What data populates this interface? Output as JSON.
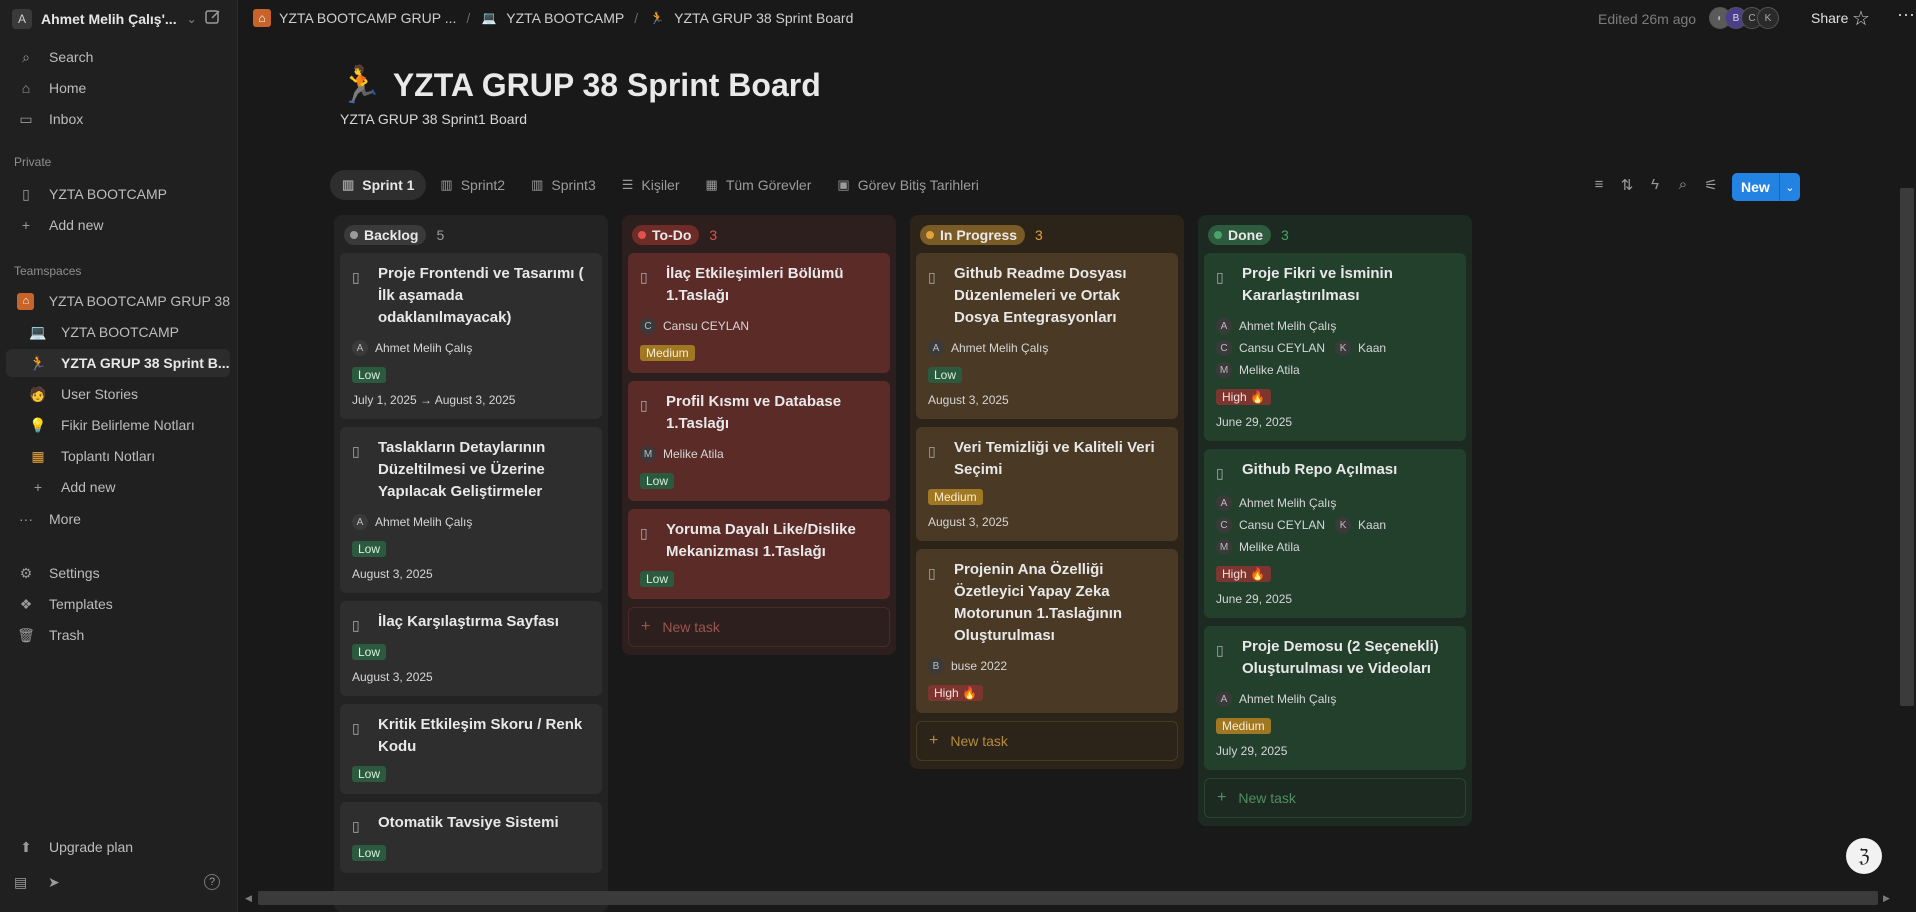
{
  "sidebar": {
    "workspace_initial": "A",
    "workspace_name": "Ahmet Melih Çalış'...",
    "nav": {
      "search": "Search",
      "home": "Home",
      "inbox": "Inbox"
    },
    "private_label": "Private",
    "private_items": [
      "YZTA BOOTCAMP"
    ],
    "add_new": "Add new",
    "teamspaces_label": "Teamspaces",
    "teamspace_root": "YZTA BOOTCAMP GRUP 38",
    "team_items": [
      {
        "label": "YZTA BOOTCAMP",
        "icon": "laptop-icon"
      },
      {
        "label": "YZTA GRUP 38 Sprint B...",
        "icon": "runner-icon"
      },
      {
        "label": "User Stories",
        "icon": "person-icon"
      },
      {
        "label": "Fikir Belirleme Notları",
        "icon": "lightbulb-icon"
      },
      {
        "label": "Toplantı Notları",
        "icon": "calendar-icon"
      }
    ],
    "team_add_new": "Add new",
    "more": "More",
    "settings": "Settings",
    "templates": "Templates",
    "trash": "Trash",
    "upgrade": "Upgrade plan"
  },
  "topbar": {
    "breadcrumbs": [
      "YZTA BOOTCAMP GRUP ...",
      "YZTA BOOTCAMP",
      "YZTA GRUP 38 Sprint Board"
    ],
    "edited": "Edited 26m ago",
    "avatars": [
      "B",
      "C",
      "K"
    ],
    "share": "Share"
  },
  "page": {
    "icon": "🏃",
    "title": "YZTA GRUP 38 Sprint Board",
    "subtitle": "YZTA GRUP 38 Sprint1 Board"
  },
  "tabs": [
    "Sprint 1",
    "Sprint2",
    "Sprint3",
    "Kişiler",
    "Tüm Görevler",
    "Görev Bitiş Tarihleri"
  ],
  "new_button": "New",
  "board": {
    "new_task": "New task",
    "columns": [
      {
        "name": "Backlog",
        "count": "5",
        "color": "#9b9b9b",
        "cards": [
          {
            "title": "Proje Frontendi ve Tasarımı ( İlk aşamada odaklanılmayacak)",
            "people": [
              [
                "A",
                "Ahmet Melih Çalış"
              ]
            ],
            "priority": "Low",
            "date": "July 1, 2025 → August 3, 2025"
          },
          {
            "title": "Taslakların Detaylarının Düzeltilmesi ve Üzerine Yapılacak Geliştirmeler",
            "people": [
              [
                "A",
                "Ahmet Melih Çalış"
              ]
            ],
            "priority": "Low",
            "date": "August 3, 2025"
          },
          {
            "title": "İlaç Karşılaştırma Sayfası",
            "people": [],
            "priority": "Low",
            "date": "August 3, 2025"
          },
          {
            "title": "Kritik Etkileşim Skoru / Renk Kodu",
            "people": [],
            "priority": "Low",
            "date": ""
          },
          {
            "title": "Otomatik Tavsiye Sistemi",
            "people": [],
            "priority": "Low",
            "date": ""
          }
        ]
      },
      {
        "name": "To-Do",
        "count": "3",
        "color": "#e0524b",
        "cards": [
          {
            "title": "İlaç Etkileşimleri Bölümü 1.Taslağı",
            "people": [
              [
                "C",
                "Cansu CEYLAN"
              ]
            ],
            "priority": "Medium",
            "date": ""
          },
          {
            "title": "Profil Kısmı ve Database 1.Taslağı",
            "people": [
              [
                "M",
                "Melike Atila"
              ]
            ],
            "priority": "Low",
            "date": ""
          },
          {
            "title": "Yoruma Dayalı Like/Dislike Mekanizması 1.Taslağı",
            "people": [],
            "priority": "Low",
            "date": ""
          }
        ]
      },
      {
        "name": "In Progress",
        "count": "3",
        "color": "#e0a23b",
        "cards": [
          {
            "title": "Github Readme Dosyası Düzenlemeleri ve Ortak Dosya Entegrasyonları",
            "people": [
              [
                "A",
                "Ahmet Melih Çalış"
              ]
            ],
            "priority": "Low",
            "date": "August 3, 2025"
          },
          {
            "title": "Veri Temizliği ve Kaliteli Veri Seçimi",
            "people": [],
            "priority": "Medium",
            "date": "August 3, 2025"
          },
          {
            "title": "Projenin Ana Özelliği Özetleyici Yapay Zeka Motorunun 1.Taslağının Oluşturulması",
            "people": [
              [
                "B",
                "buse 2022"
              ]
            ],
            "priority": "High 🔥",
            "date": ""
          }
        ]
      },
      {
        "name": "Done",
        "count": "3",
        "color": "#4aa36a",
        "cards": [
          {
            "title": "Proje Fikri ve İsminin Kararlaştırılması",
            "people": [
              [
                "A",
                "Ahmet Melih Çalış"
              ],
              [
                "C",
                "Cansu CEYLAN"
              ],
              [
                "K",
                "Kaan"
              ],
              [
                "M",
                "Melike Atila"
              ]
            ],
            "priority": "High 🔥",
            "date": "June 29, 2025"
          },
          {
            "title": "Github Repo Açılması",
            "people": [
              [
                "A",
                "Ahmet Melih Çalış"
              ],
              [
                "C",
                "Cansu CEYLAN"
              ],
              [
                "K",
                "Kaan"
              ],
              [
                "M",
                "Melike Atila"
              ]
            ],
            "priority": "High 🔥",
            "date": "June 29, 2025"
          },
          {
            "title": "Proje Demosu (2 Seçenekli) Oluşturulması ve Videoları",
            "people": [
              [
                "A",
                "Ahmet Melih Çalış"
              ]
            ],
            "priority": "Medium",
            "date": "July 29, 2025"
          }
        ]
      }
    ]
  }
}
